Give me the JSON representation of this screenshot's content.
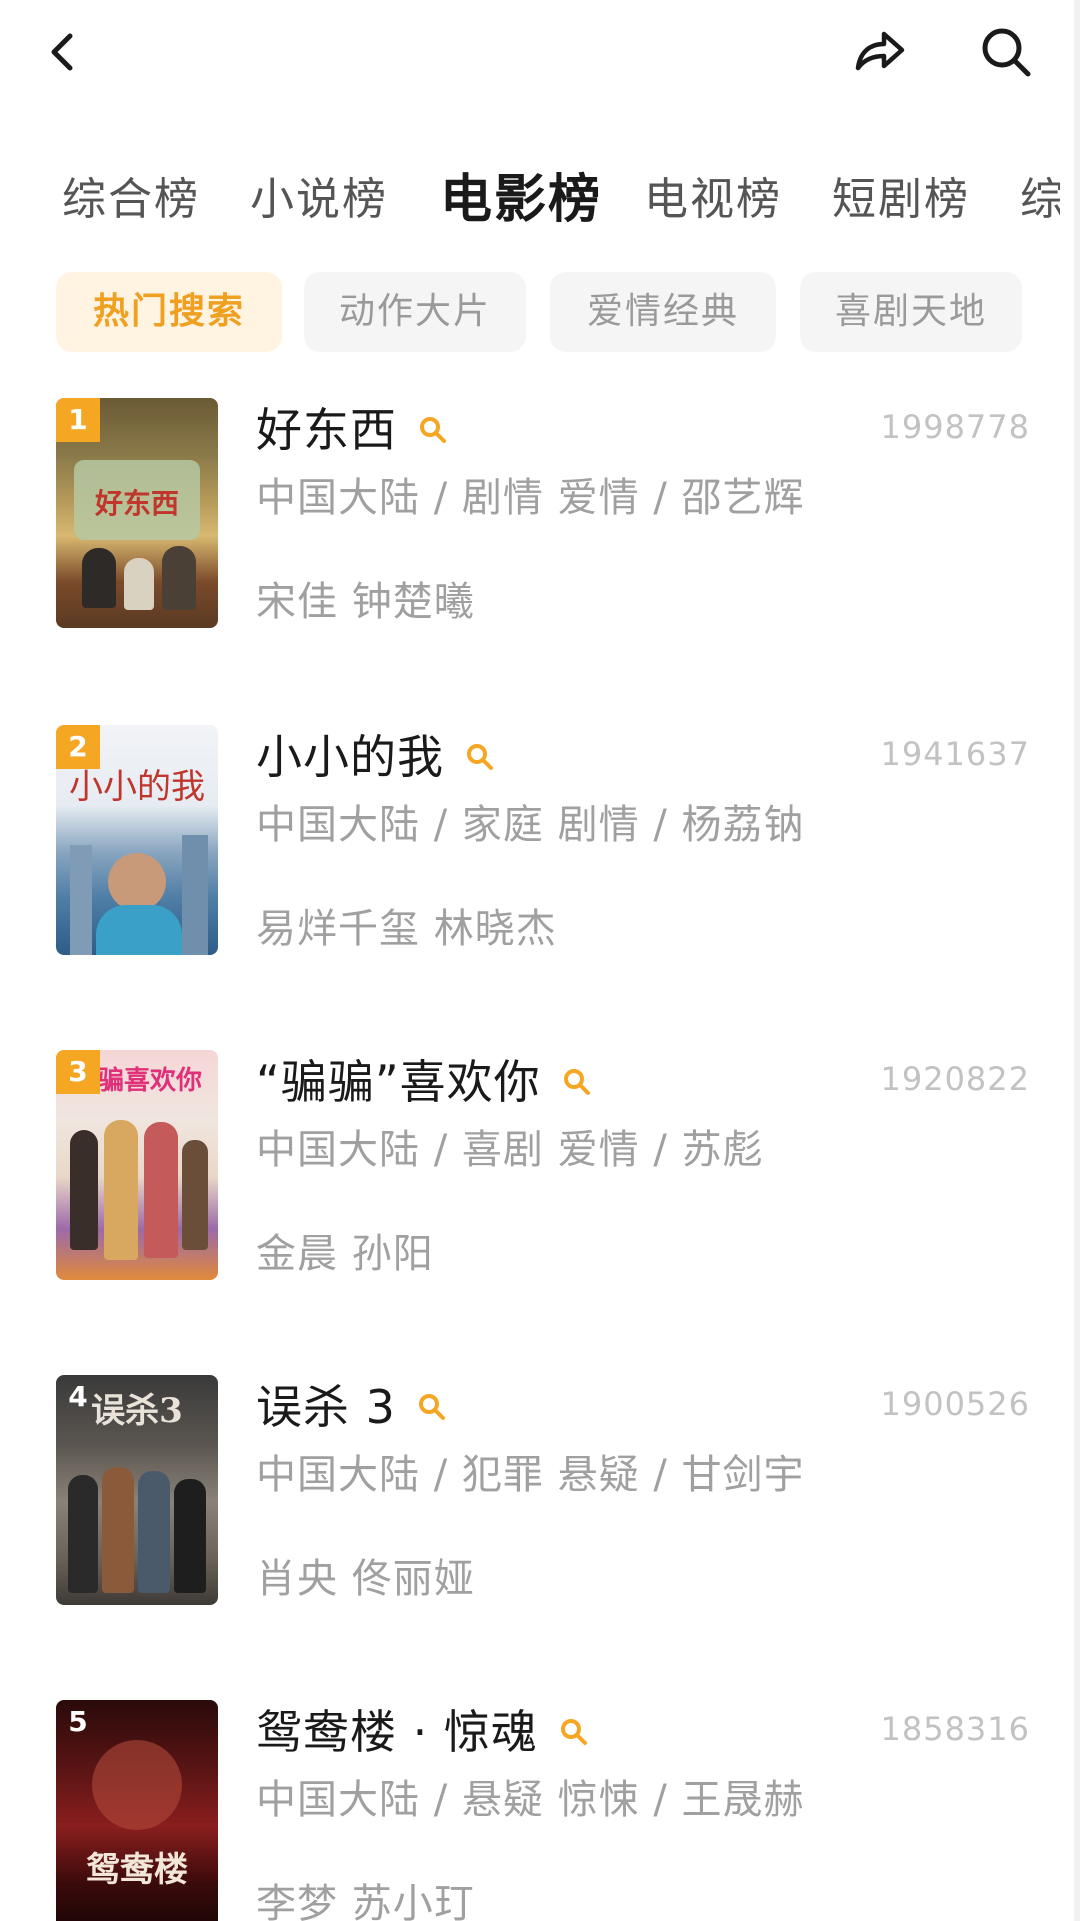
{
  "header": {
    "back_icon": "chevron-left-icon",
    "share_icon": "share-arrow-icon",
    "search_icon": "search-icon"
  },
  "tabs": [
    {
      "label": "综合榜",
      "active": false
    },
    {
      "label": "小说榜",
      "active": false
    },
    {
      "label": "电影榜",
      "active": true
    },
    {
      "label": "电视榜",
      "active": false
    },
    {
      "label": "短剧榜",
      "active": false
    },
    {
      "label": "综",
      "active": false
    }
  ],
  "chips": [
    {
      "label": "热门搜索",
      "active": true
    },
    {
      "label": "动作大片",
      "active": false
    },
    {
      "label": "爱情经典",
      "active": false
    },
    {
      "label": "喜剧天地",
      "active": false
    }
  ],
  "colors": {
    "accent": "#f5a623",
    "chip_active_bg": "#fff3e2",
    "chip_active_text": "#f0a020",
    "muted_text": "#a0a0a0"
  },
  "movies": [
    {
      "rank": "1",
      "title": "好东西",
      "meta": "中国大陆 / 剧情 爱情 / 邵艺辉",
      "cast": "宋佳 钟楚曦",
      "score": "1998778",
      "poster_text": "好东西"
    },
    {
      "rank": "2",
      "title": "小小的我",
      "meta": "中国大陆 / 家庭 剧情 / 杨荔钠",
      "cast": "易烊千玺 林晓杰",
      "score": "1941637",
      "poster_text": "小小的我"
    },
    {
      "rank": "3",
      "title": "“骗骗”喜欢你",
      "meta": "中国大陆 / 喜剧 爱情 / 苏彪",
      "cast": "金晨 孙阳",
      "score": "1920822",
      "poster_text": "骗骗喜欢你"
    },
    {
      "rank": "4",
      "title": "误杀 3",
      "meta": "中国大陆 / 犯罪 悬疑 / 甘剑宇",
      "cast": "肖央 佟丽娅",
      "score": "1900526",
      "poster_text": "误杀3"
    },
    {
      "rank": "5",
      "title": "鸳鸯楼 · 惊魂",
      "meta": "中国大陆 / 悬疑 惊悚 / 王晟赫",
      "cast": "李梦 苏小玎",
      "score": "1858316",
      "poster_text": "鸳鸯楼"
    }
  ]
}
